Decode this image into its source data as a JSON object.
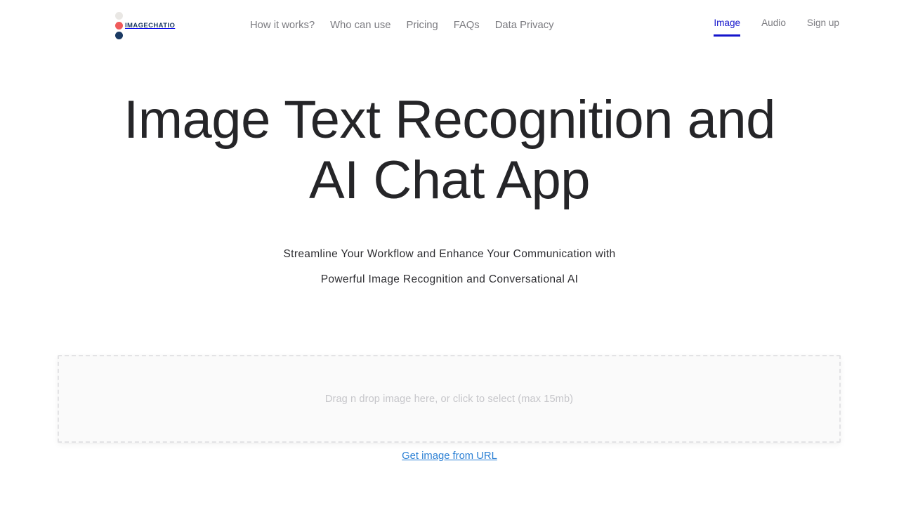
{
  "brand": {
    "wordmark": "IMAGECHATIO",
    "dots": [
      {
        "name": "logo-dot-top",
        "color": "#e9e7e4"
      },
      {
        "name": "logo-dot-middle",
        "color": "#ef5b5b"
      },
      {
        "name": "logo-dot-bottom",
        "color": "#1b3a63"
      }
    ],
    "wordmark_color": "#1b3a63"
  },
  "nav": {
    "items": [
      {
        "label": "How it works?"
      },
      {
        "label": "Who can use"
      },
      {
        "label": "Pricing"
      },
      {
        "label": "FAQs"
      },
      {
        "label": "Data Privacy"
      }
    ],
    "link_color": "#7b7b80"
  },
  "right_nav": {
    "items": [
      {
        "label": "Image",
        "active": true
      },
      {
        "label": "Audio",
        "active": false
      },
      {
        "label": "Sign up",
        "active": false
      }
    ],
    "active_color": "#1515cc",
    "inactive_color": "#7b7b80"
  },
  "hero": {
    "title_line1": "Image Text Recognition and",
    "title_line2": "AI Chat App",
    "title_color": "#252528",
    "subtitle_line1": "Streamline Your Workflow and Enhance Your Communication with",
    "subtitle_line2": "Powerful Image Recognition and Conversational AI",
    "subtitle_color": "#2c2c30"
  },
  "dropzone": {
    "placeholder": "Drag n drop image here, or click to select (max 15mb)",
    "placeholder_color": "#c6c6ca",
    "background": "#fafafa",
    "border_color": "#e3e3e5",
    "max_size": "15mb"
  },
  "url_link": {
    "label": "Get image from URL",
    "color": "#2a7fd4"
  }
}
